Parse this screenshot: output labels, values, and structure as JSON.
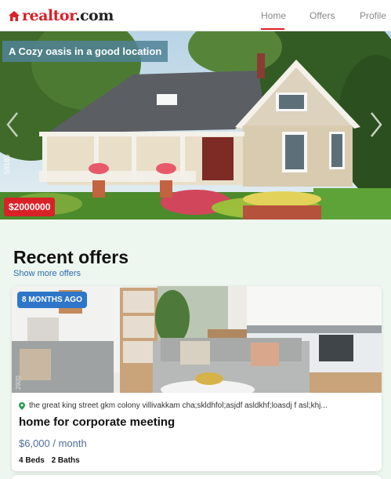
{
  "header": {
    "logo_text_red": "realtor",
    "logo_text_dark": ".com",
    "nav": [
      {
        "label": "Home",
        "active": true
      },
      {
        "label": "Offers",
        "active": false
      },
      {
        "label": "Profile",
        "active": false
      }
    ],
    "accent_color": "#d92228"
  },
  "hero": {
    "title": "A Cozy oasis in a good location",
    "price": "$2000000",
    "watermark": "59185",
    "prev_icon": "chevron-left-icon",
    "next_icon": "chevron-right-icon"
  },
  "section": {
    "title": "Recent offers",
    "show_more": "Show more offers"
  },
  "offers": [
    {
      "badge": "8 MONTHS AGO",
      "watermark": "2920",
      "address": "the great king street gkm colony villivakkam cha;skldhfol;asjdf asldkhf;loasdj f asl;khj...",
      "title": "home for corporate meeting",
      "price": "$6,000 / month",
      "beds": "4 Beds",
      "baths": "2 Baths"
    }
  ]
}
